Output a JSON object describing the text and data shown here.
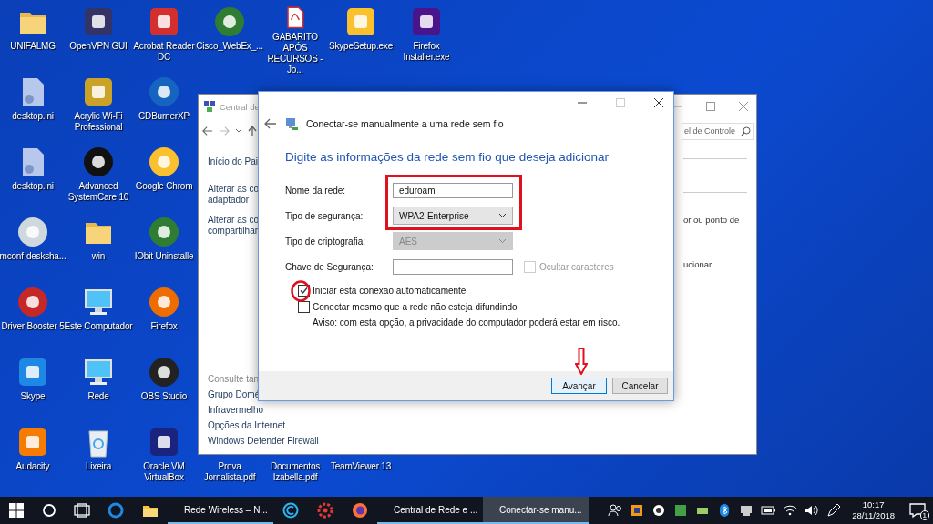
{
  "desktop_icons": [
    {
      "kind": "folder",
      "label": "UNIFALMG"
    },
    {
      "kind": "file",
      "label": "desktop.ini"
    },
    {
      "kind": "file",
      "label": "desktop.ini"
    },
    {
      "kind": "round",
      "color": "#cfd8dc",
      "label": "mconf-desksha..."
    },
    {
      "kind": "round",
      "color": "#c62828",
      "label": "Driver Booster 5"
    },
    {
      "kind": "app",
      "color": "#1e88e5",
      "label": "Skype"
    },
    {
      "kind": "app",
      "color": "#f57c00",
      "label": "Audacity"
    },
    {
      "kind": "app",
      "color": "#333366",
      "label": "OpenVPN GUI"
    },
    {
      "kind": "app",
      "color": "#c9a227",
      "label": "Acrylic Wi-Fi Professional"
    },
    {
      "kind": "round",
      "color": "#111111",
      "label": "Advanced SystemCare 10"
    },
    {
      "kind": "folder",
      "label": "win"
    },
    {
      "kind": "monitor",
      "label": "Este Computador"
    },
    {
      "kind": "monitor",
      "label": "Rede"
    },
    {
      "kind": "recycle",
      "label": "Lixeira"
    },
    {
      "kind": "app",
      "color": "#d32f2f",
      "label": "Acrobat Reader DC"
    },
    {
      "kind": "round",
      "color": "#1565c0",
      "label": "CDBurnerXP"
    },
    {
      "kind": "round",
      "color": "#fbc02d",
      "label": "Google Chrom"
    },
    {
      "kind": "round",
      "color": "#2e7d32",
      "label": "IObit Uninstalle"
    },
    {
      "kind": "round",
      "color": "#ef6c00",
      "label": "Firefox"
    },
    {
      "kind": "round",
      "color": "#222222",
      "label": "OBS Studio"
    },
    {
      "kind": "app",
      "color": "#1a237e",
      "label": "Oracle VM VirtualBox"
    },
    {
      "kind": "round",
      "color": "#2e7d32",
      "label": "Cisco_WebEx_..."
    },
    {
      "kind": "covered"
    },
    {
      "kind": "covered"
    },
    {
      "kind": "covered"
    },
    {
      "kind": "covered"
    },
    {
      "kind": "covered"
    },
    {
      "kind": "covered",
      "label": "Prova Jornalista.pdf"
    },
    {
      "kind": "pdf",
      "label": "GABARITO APÓS RECURSOS - Jo..."
    },
    {
      "kind": "covered"
    },
    {
      "kind": "covered"
    },
    {
      "kind": "covered"
    },
    {
      "kind": "covered"
    },
    {
      "kind": "covered"
    },
    {
      "kind": "covered",
      "label": "Documentos Izabella.pdf"
    },
    {
      "kind": "app",
      "color": "#fbc02d",
      "label": "SkypeSetup.exe"
    },
    {
      "kind": "covered"
    },
    {
      "kind": "covered"
    },
    {
      "kind": "covered"
    },
    {
      "kind": "covered"
    },
    {
      "kind": "covered"
    },
    {
      "kind": "covered",
      "label": "TeamViewer 13"
    },
    {
      "kind": "app",
      "color": "#4a148c",
      "label": "Firefox Installer.exe"
    }
  ],
  "control_panel": {
    "title": "Central de",
    "search": {
      "value": "el de Controle"
    },
    "left_links": [
      "Início do Pai",
      "Alterar as co\nadaptador",
      "Alterar as co\ncompartilhar"
    ],
    "see_also": {
      "heading": "Consulte tan",
      "links": [
        "Grupo Domé",
        "Infravermelho",
        "Opções da Internet",
        "Windows Defender Firewall"
      ]
    },
    "right_texts": [
      "or ou ponto de",
      "ucionar"
    ]
  },
  "dialog": {
    "title": "Conectar-se manualmente a uma rede sem fio",
    "heading": "Digite as informações da rede sem fio que deseja adicionar",
    "fields": [
      {
        "kind": "text",
        "label": "Nome da rede:",
        "value": "eduroam",
        "disabled": false
      },
      {
        "kind": "select",
        "label": "Tipo de segurança:",
        "value": "WPA2-Enterprise",
        "disabled": false
      },
      {
        "kind": "select",
        "label": "Tipo de criptografia:",
        "value": "AES",
        "disabled": true
      },
      {
        "kind": "text",
        "label": "Chave de Segurança:",
        "disabled": false,
        "option": {
          "label": "Ocultar caracteres",
          "checked": false,
          "disabled": true
        }
      }
    ],
    "options": [
      {
        "label": "Iniciar esta conexão automaticamente",
        "checked": true
      },
      {
        "label": "Conectar mesmo que a rede não esteja difundindo",
        "checked": false
      }
    ],
    "warning": "Aviso: com esta opção, a privacidade do computador poderá estar em risco.",
    "buttons": [
      {
        "label": "Avançar",
        "default": true
      },
      {
        "label": "Cancelar",
        "default": false
      }
    ]
  },
  "taskbar": {
    "apps": [
      {
        "kind": "edge",
        "selected": false
      },
      {
        "kind": "explorer",
        "selected": false
      },
      {
        "kind": "chrome",
        "label": "Rede Wireless – N...",
        "selected": false
      },
      {
        "kind": "ring",
        "selected": false
      },
      {
        "kind": "gear",
        "selected": false
      },
      {
        "kind": "firefox",
        "selected": false
      },
      {
        "kind": "network",
        "label": "Central de Rede e ...",
        "selected": false
      },
      {
        "kind": "wizard",
        "label": "Conectar-se manu...",
        "selected": true
      }
    ],
    "time": "10:17",
    "date": "28/11/2018",
    "notifications": "1"
  }
}
